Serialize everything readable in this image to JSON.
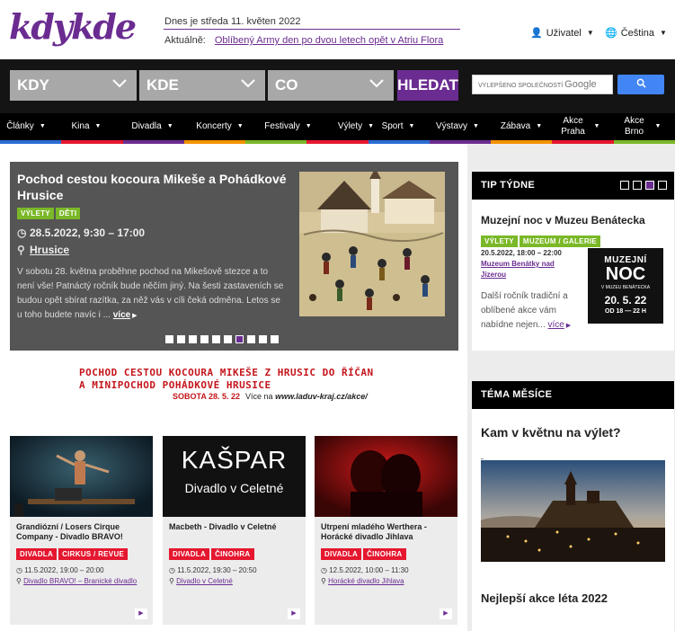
{
  "header": {
    "logo_text": "kdykde",
    "today": "Dnes je středa 11. květen 2022",
    "aktualne_label": "Aktuálně:",
    "aktualne_link": "Oblíbený Army den po dvou letech opět v Atriu Flora",
    "user_menu": "Uživatel",
    "language_menu": "Čeština"
  },
  "search": {
    "kdy": "KDY",
    "kde": "KDE",
    "co": "CO",
    "button": "HLEDAT",
    "google_placeholder": "VYLEPŠENO SPOLEČNOSTÍ",
    "google_brand": "Google"
  },
  "nav": {
    "items": [
      "Články",
      "Kina",
      "Divadla",
      "Koncerty",
      "Festivaly",
      "Výlety",
      "Sport",
      "Výstavy",
      "Zábava",
      "Akce Praha",
      "Akce Brno"
    ]
  },
  "colors": {
    "brand": "#6b2c91",
    "strip": [
      "#2b6cd4",
      "#e5172f",
      "#6b2c91",
      "#f39200",
      "#7ab827",
      "#e5172f",
      "#2b6cd4",
      "#6b2c91",
      "#f39200",
      "#e5172f",
      "#7ab827"
    ]
  },
  "slider": {
    "title": "Pochod cestou kocoura Mikeše a Pohádkové Hrusice",
    "tags": [
      "VÝLETY",
      "DĚTI"
    ],
    "date": "28.5.2022, 9:30 – 17:00",
    "place": "Hrusice",
    "text": "V sobotu 28. května proběhne pochod na Mikešově stezce a to není vše! Patnáctý ročník bude něčím jiný. Na šesti zastaveních se budou opět sbírat razítka, za něž vás v cíli čeká odměna. Letos se u toho budete navíc i ...",
    "more": "více",
    "dots": 10,
    "active_dot": 7
  },
  "banner": {
    "line1": "Pochod cestou kocoura Mikeše z Hrusic do Říčan",
    "line2": "a minipochod pohádkové Hrusice",
    "date": "SOBOTA 28. 5. 22",
    "more_label": "Více na",
    "url": "www.laduv-kraj.cz/akce/"
  },
  "cards": [
    {
      "title": "Grandiózní / Losers Cirque Company - Divadlo BRAVO!",
      "tags": [
        "DIVADLA",
        "CIRKUS / REVUE"
      ],
      "date": "11.5.2022, 19:00 – 20:00",
      "place": "Divadlo BRAVO! – Branické divadlo"
    },
    {
      "title": "Macbeth - Divadlo v Celetné",
      "tags": [
        "DIVADLA",
        "ČINOHRA"
      ],
      "date": "11.5.2022, 19:30 – 20:50",
      "place": "Divadlo v Celetné",
      "img_line1": "KAŠPAR",
      "img_line2": "Divadlo v Celetné"
    },
    {
      "title": "Utrpení mladého Werthera - Horácké divadlo Jihlava",
      "tags": [
        "DIVADLA",
        "ČINOHRA"
      ],
      "date": "12.5.2022, 10:00 – 11:30",
      "place": "Horácké divadlo Jihlava"
    }
  ],
  "tip": {
    "heading": "TIP TÝDNE",
    "dots": 4,
    "active_dot": 3,
    "title": "Muzejní noc v Muzeu Benátecka",
    "tags": [
      "VÝLETY",
      "MUZEUM / GALERIE"
    ],
    "date": "20.5.2022, 18:00 – 22:00",
    "place": "Muzeum Benátky nad Jizerou",
    "text": "Další ročník tradiční a oblíbené akce vám nabídne nejen...",
    "more": "více",
    "img_line1": "MUZEJNÍ",
    "img_line2": "NOC",
    "img_line3": "V MUZEU BENÁTECKA",
    "img_line4": "20. 5. 22",
    "img_line5": "OD 18 — 22 H"
  },
  "tema": {
    "heading": "TÉMA MĚSÍCE",
    "title": "Kam v květnu na výlet?",
    "dash": "-",
    "next": "Nejlepší akce léta 2022"
  }
}
